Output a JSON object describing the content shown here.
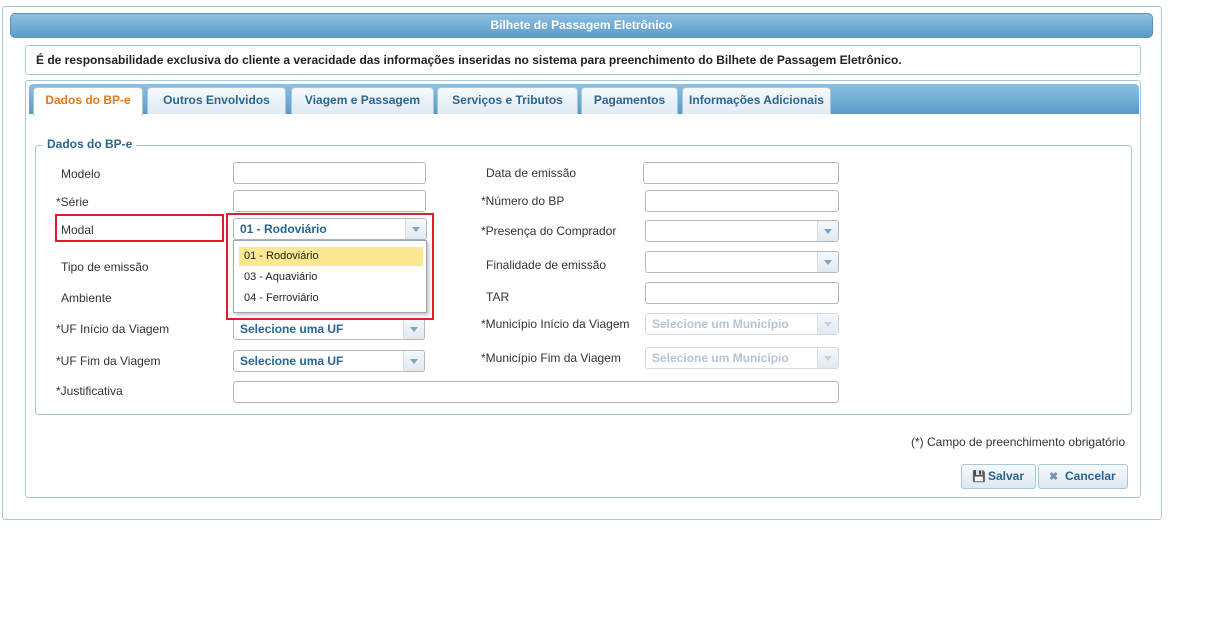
{
  "window": {
    "title": "Bilhete de Passagem Eletrônico"
  },
  "notice": "É de responsabilidade exclusiva do cliente a veracidade das informações inseridas no sistema para preenchimento do Bilhete de Passagem Eletrônico.",
  "tabs": [
    {
      "label": "Dados do BP-e",
      "active": true
    },
    {
      "label": "Outros Envolvidos"
    },
    {
      "label": "Viagem e Passagem"
    },
    {
      "label": "Serviços e Tributos"
    },
    {
      "label": "Pagamentos"
    },
    {
      "label": "Informações Adicionais"
    }
  ],
  "section_title": "Dados do BP-e",
  "left_fields": {
    "modelo": {
      "label": "Modelo",
      "value": ""
    },
    "serie": {
      "label": "*Série",
      "value": ""
    },
    "modal": {
      "label": "Modal",
      "value": "01 - Rodoviário"
    },
    "tipo_emissao": {
      "label": "Tipo de emissão"
    },
    "ambiente": {
      "label": "Ambiente"
    },
    "uf_inicio": {
      "label": "*UF Início da Viagem",
      "value": "Selecione uma UF"
    },
    "uf_fim": {
      "label": "*UF Fim da Viagem",
      "value": "Selecione uma UF"
    },
    "justificativa": {
      "label": "*Justificativa",
      "value": ""
    }
  },
  "right_fields": {
    "data_emissao": {
      "label": "Data de emissão",
      "value": ""
    },
    "numero_bp": {
      "label": "*Número do BP",
      "value": ""
    },
    "presenca": {
      "label": "*Presença do Comprador",
      "value": ""
    },
    "finalidade": {
      "label": "Finalidade de emissão",
      "value": ""
    },
    "tar": {
      "label": "TAR",
      "value": ""
    },
    "municipio_inicio": {
      "label": "*Município Início da Viagem",
      "value": "Selecione um Município"
    },
    "municipio_fim": {
      "label": "*Município Fim da Viagem",
      "value": "Selecione um Município"
    }
  },
  "modal_dropdown": {
    "options": [
      "01 - Rodoviário",
      "03 - Aquaviário",
      "04 - Ferroviário"
    ],
    "highlighted": "01 - Rodoviário"
  },
  "required_note": "(*) Campo de preenchimento obrigatório",
  "buttons": {
    "save": "Salvar",
    "cancel": "Cancelar"
  },
  "colors": {
    "accent": "#2a6590",
    "active_tab": "#e0781e",
    "highlight": "#fde892",
    "callout": "#dd1d2a"
  }
}
